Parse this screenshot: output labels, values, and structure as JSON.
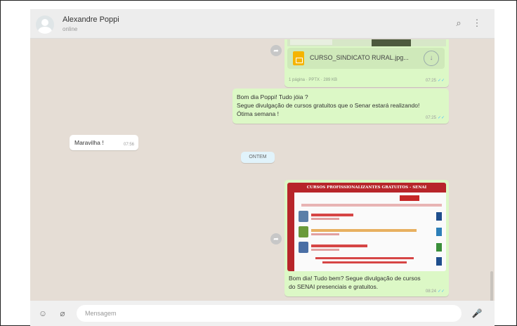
{
  "header": {
    "contact_name": "Alexandre Poppi",
    "contact_status": "online",
    "search_icon": "⌕",
    "menu_icon": "⋮"
  },
  "chat": {
    "document_message": {
      "preview_caption": "1 página · PPTX · 289 KB",
      "file_name": "CURSO_SINDICATO RURAL.jpg...",
      "time": "07:25"
    },
    "text_message_1": {
      "line1": "Bom dia Poppi! Tudo jóia ?",
      "line2": "Segue divulgação de cursos gratuitos que o Senar estará realizando!",
      "line3": "Ótima semana !",
      "time": "07:25"
    },
    "incoming_message": {
      "text": "Maravilha !",
      "time": "07:56"
    },
    "date_separator": "ONTEM",
    "image_message": {
      "poster_title": "CURSOS PROFISSIONALIZANTES GRATUITOS - SENAI",
      "caption_line1": "Bom dia! Tudo bem? Segue divulgação de cursos",
      "caption_line2": "do SENAI presenciais e gratuitos.",
      "time": "08:24"
    },
    "tick_icon": "✓✓"
  },
  "composer": {
    "placeholder": "Mensagem",
    "emoji_icon": "☺",
    "attach_icon": "⌀",
    "mic_icon": "🎤"
  }
}
